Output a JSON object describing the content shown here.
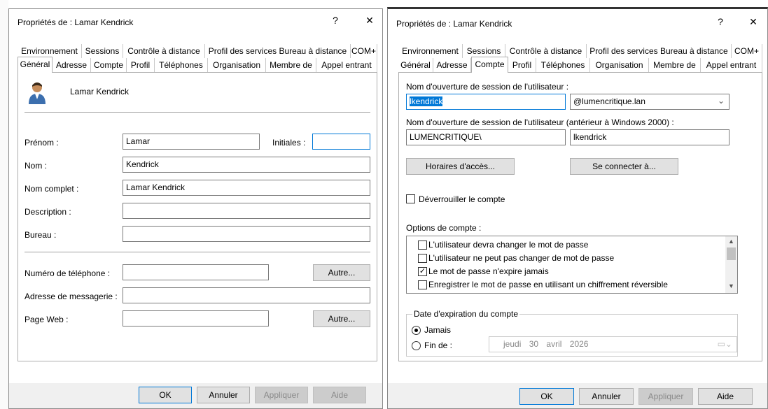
{
  "left": {
    "title": "Propriétés de : Lamar Kendrick",
    "help_glyph": "?",
    "close_glyph": "✕",
    "tabs_back": [
      "Environnement",
      "Sessions",
      "Contrôle à distance",
      "Profil des services Bureau à distance",
      "COM+"
    ],
    "tabs_front": [
      "Général",
      "Adresse",
      "Compte",
      "Profil",
      "Téléphones",
      "Organisation",
      "Membre de",
      "Appel entrant"
    ],
    "display_name": "Lamar Kendrick",
    "labels": {
      "prenom": "Prénom :",
      "initiales": "Initiales :",
      "nom": "Nom :",
      "nom_complet": "Nom complet :",
      "description": "Description :",
      "bureau": "Bureau :",
      "telephone": "Numéro de téléphone :",
      "messagerie": "Adresse de messagerie :",
      "web": "Page Web :"
    },
    "values": {
      "prenom": "Lamar",
      "initiales": "",
      "nom": "Kendrick",
      "nom_complet": "Lamar Kendrick",
      "description": "",
      "bureau": "",
      "telephone": "",
      "messagerie": "",
      "web": ""
    },
    "autre_label": "Autre...",
    "buttons": {
      "ok": "OK",
      "annuler": "Annuler",
      "appliquer": "Appliquer",
      "aide": "Aide"
    }
  },
  "right": {
    "title": "Propriétés de : Lamar Kendrick",
    "help_glyph": "?",
    "close_glyph": "✕",
    "tabs_back": [
      "Environnement",
      "Sessions",
      "Contrôle à distance",
      "Profil des services Bureau à distance",
      "COM+"
    ],
    "tabs_front": [
      "Général",
      "Adresse",
      "Compte",
      "Profil",
      "Téléphones",
      "Organisation",
      "Membre de",
      "Appel entrant"
    ],
    "logon_label": "Nom d'ouverture de session de l'utilisateur :",
    "logon_value": "lkendrick",
    "domain_value": "@lumencritique.lan",
    "logon_pre2000_label": "Nom d'ouverture de session de l'utilisateur (antérieur à Windows 2000) :",
    "netbios_value": "LUMENCRITIQUE\\",
    "pre2000_value": "lkendrick",
    "horaires_button": "Horaires d'accès...",
    "connect_button": "Se connecter à...",
    "unlock_label": "Déverrouiller le compte",
    "options_label": "Options de compte :",
    "options": [
      {
        "label": "L'utilisateur devra changer le mot de passe",
        "checked": false
      },
      {
        "label": "L'utilisateur ne peut pas changer de mot de passe",
        "checked": false
      },
      {
        "label": "Le mot de passe n'expire jamais",
        "checked": true
      },
      {
        "label": "Enregistrer le mot de passe en utilisant un chiffrement réversible",
        "checked": false
      }
    ],
    "expiration_label": "Date d'expiration du compte",
    "jamais_label": "Jamais",
    "finde_label": "Fin de :",
    "date": {
      "day_name": "jeudi",
      "day": "30",
      "month": "avril",
      "year": "2026"
    },
    "buttons": {
      "ok": "OK",
      "annuler": "Annuler",
      "appliquer": "Appliquer",
      "aide": "Aide"
    }
  }
}
